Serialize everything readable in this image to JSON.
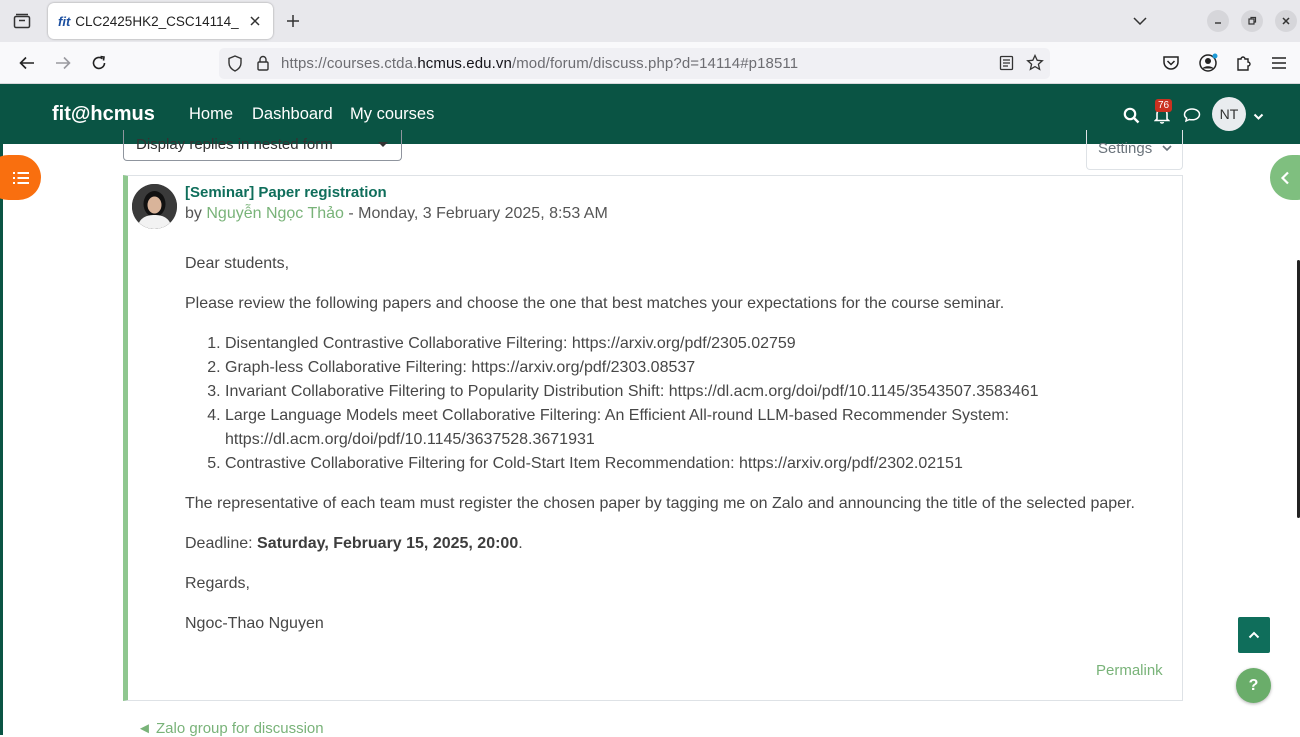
{
  "browser": {
    "tab_title": "CLC2425HK2_CSC14114_",
    "tab_favicon_text": "fit",
    "url_prefix": "https://courses.ctda.",
    "url_domain": "hcmus.edu.vn",
    "url_path": "/mod/forum/discuss.php?d=14114#p18511"
  },
  "header": {
    "brand": "fit@hcmus",
    "nav": [
      "Home",
      "Dashboard",
      "My courses"
    ],
    "notification_count": "76",
    "avatar_initials": "NT"
  },
  "controls": {
    "display_mode": "Display replies in nested form",
    "settings_label": "Settings"
  },
  "post": {
    "subject": "[Seminar] Paper registration",
    "by_label": "by",
    "author": "Nguyễn Ngọc Thảo",
    "date": "- Monday, 3 February 2025, 8:53 AM",
    "greeting": "Dear students,",
    "intro": "Please review the following papers and choose the one that best matches your expectations for the course seminar.",
    "papers": [
      "Disentangled Contrastive Collaborative Filtering: https://arxiv.org/pdf/2305.02759",
      "Graph-less Collaborative Filtering: https://arxiv.org/pdf/2303.08537",
      "Invariant Collaborative Filtering to Popularity Distribution Shift: https://dl.acm.org/doi/pdf/10.1145/3543507.3583461",
      "Large Language Models meet Collaborative Filtering: An Efficient All-round LLM-based Recommender System: https://dl.acm.org/doi/pdf/10.1145/3637528.3671931",
      "Contrastive Collaborative Filtering for Cold-Start Item Recommendation: https://arxiv.org/pdf/2302.02151"
    ],
    "instruction": "The representative of each team must register the chosen paper by tagging me on Zalo and announcing the title of the selected paper.",
    "deadline_label": "Deadline: ",
    "deadline_value": "Saturday, February 15, 2025, 20:00",
    "deadline_end": ".",
    "regards": "Regards,",
    "signature": "Ngoc-Thao Nguyen",
    "permalink": "Permalink"
  },
  "footer": {
    "prev_link": "◄ Zalo group for discussion",
    "help": "?"
  },
  "colors": {
    "header_bg": "#0a5444",
    "accent_green": "#8fc78f",
    "link_green": "#79b379",
    "subject_green": "#0f6e5b",
    "drawer_orange": "#f96f0f"
  }
}
